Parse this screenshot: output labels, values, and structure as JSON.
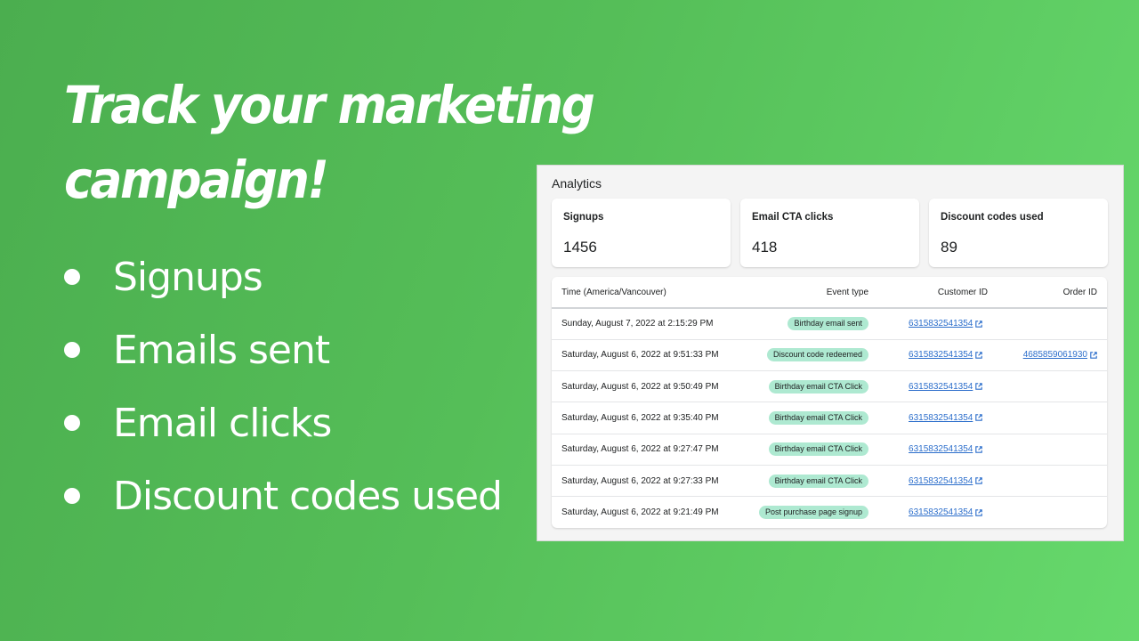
{
  "hero": {
    "headline_line1": "Track your marketing",
    "headline_line2": "campaign!",
    "bullets": [
      "Signups",
      "Emails sent",
      "Email clicks",
      "Discount codes used"
    ]
  },
  "colors": {
    "background_start": "#4bae4f",
    "background_end": "#66d96c",
    "badge": "#aee9d1",
    "link": "#2c6ecb"
  },
  "analytics": {
    "title": "Analytics",
    "cards": [
      {
        "label": "Signups",
        "value": "1456"
      },
      {
        "label": "Email CTA clicks",
        "value": "418"
      },
      {
        "label": "Discount codes used",
        "value": "89"
      }
    ],
    "table": {
      "headers": [
        "Time (America/Vancouver)",
        "Event type",
        "Customer ID",
        "Order ID"
      ],
      "rows": [
        {
          "time": "Sunday, August 7, 2022 at 2:15:29 PM",
          "event": "Birthday email sent",
          "customer_id": "6315832541354",
          "order_id": ""
        },
        {
          "time": "Saturday, August 6, 2022 at 9:51:33 PM",
          "event": "Discount code redeemed",
          "customer_id": "6315832541354",
          "order_id": "4685859061930"
        },
        {
          "time": "Saturday, August 6, 2022 at 9:50:49 PM",
          "event": "Birthday email CTA Click",
          "customer_id": "6315832541354",
          "order_id": ""
        },
        {
          "time": "Saturday, August 6, 2022 at 9:35:40 PM",
          "event": "Birthday email CTA Click",
          "customer_id": "6315832541354",
          "order_id": ""
        },
        {
          "time": "Saturday, August 6, 2022 at 9:27:47 PM",
          "event": "Birthday email CTA Click",
          "customer_id": "6315832541354",
          "order_id": ""
        },
        {
          "time": "Saturday, August 6, 2022 at 9:27:33 PM",
          "event": "Birthday email CTA Click",
          "customer_id": "6315832541354",
          "order_id": ""
        },
        {
          "time": "Saturday, August 6, 2022 at 9:21:49 PM",
          "event": "Post purchase page signup",
          "customer_id": "6315832541354",
          "order_id": ""
        }
      ]
    },
    "icons": {
      "external_link": "external-link-icon"
    }
  }
}
